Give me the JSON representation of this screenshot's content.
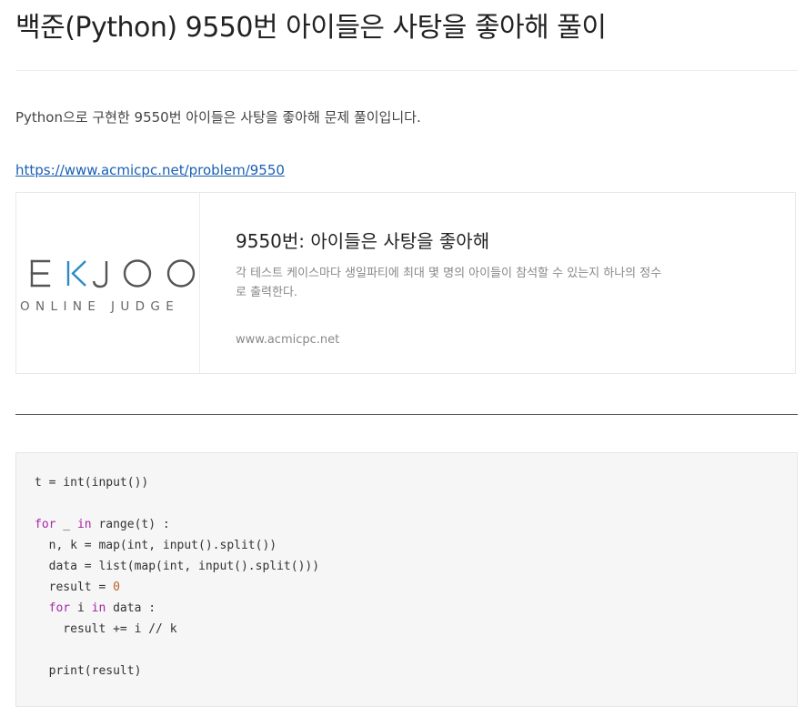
{
  "post": {
    "title": "백준(Python) 9550번 아이들은 사탕을 좋아해 풀이",
    "intro": "Python으로 구현한 9550번 아이들은 사탕을 좋아해 문제 풀이입니다.",
    "link_text": "https://www.acmicpc.net/problem/9550"
  },
  "card": {
    "logo_wordmark": "EKJOO",
    "logo_subtitle": "ONLINE JUDGE",
    "title": "9550번: 아이들은 사탕을 좋아해",
    "description": "각 테스트 케이스마다 생일파티에 최대 몇 명의 아이들이 참석할 수 있는지 하나의 정수로 출력한다.",
    "host": "www.acmicpc.net",
    "logo_color": "#555555",
    "logo_accent_color": "#2b8ac6"
  },
  "code": {
    "line1": {
      "t": "t = int(input())"
    },
    "line3": {
      "kw1": "for",
      "a": " _ ",
      "kw2": "in",
      "b": " range(t) :"
    },
    "line4": {
      "t": "  n, k = map(int, input().split())"
    },
    "line5": {
      "t": "  data = list(map(int, input().split()))"
    },
    "line6": {
      "a": "  result = ",
      "n": "0"
    },
    "line7": {
      "pre": "  ",
      "kw1": "for",
      "a": " i ",
      "kw2": "in",
      "b": " data :"
    },
    "line8": {
      "t": "    result += i // k"
    },
    "line10": {
      "t": "  print(result)"
    }
  },
  "colors": {
    "keyword": "#a626a4",
    "number": "#b7642a",
    "link": "#1a5fb4"
  }
}
